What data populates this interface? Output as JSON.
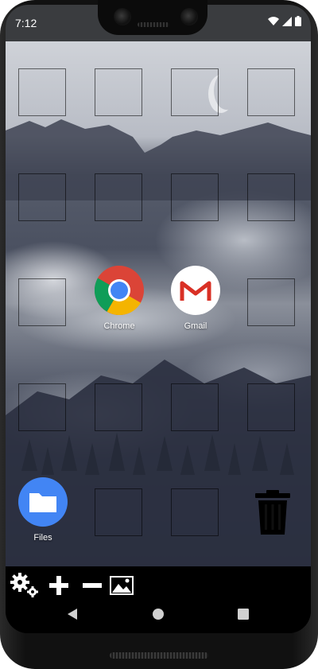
{
  "status_bar": {
    "time": "7:12"
  },
  "home": {
    "apps": [
      {
        "label": "Chrome",
        "icon": "chrome-icon"
      },
      {
        "label": "Gmail",
        "icon": "gmail-icon"
      }
    ],
    "dock_app": {
      "label": "Files",
      "icon": "folder-icon",
      "color": "#4285f4"
    },
    "trash_icon": "trash-icon"
  },
  "toolbar": {
    "icons": [
      "settings-icon",
      "add-icon",
      "remove-icon",
      "wallpaper-icon"
    ]
  },
  "navigation": {
    "icons": [
      "back-icon",
      "home-icon",
      "recents-icon"
    ]
  },
  "colors": {
    "status_bar": "#3a3c3f",
    "toolbar": "#000000",
    "chrome_red": "#db4437",
    "chrome_green": "#0f9d58",
    "chrome_yellow": "#f4b400",
    "chrome_blue": "#4285f4"
  }
}
